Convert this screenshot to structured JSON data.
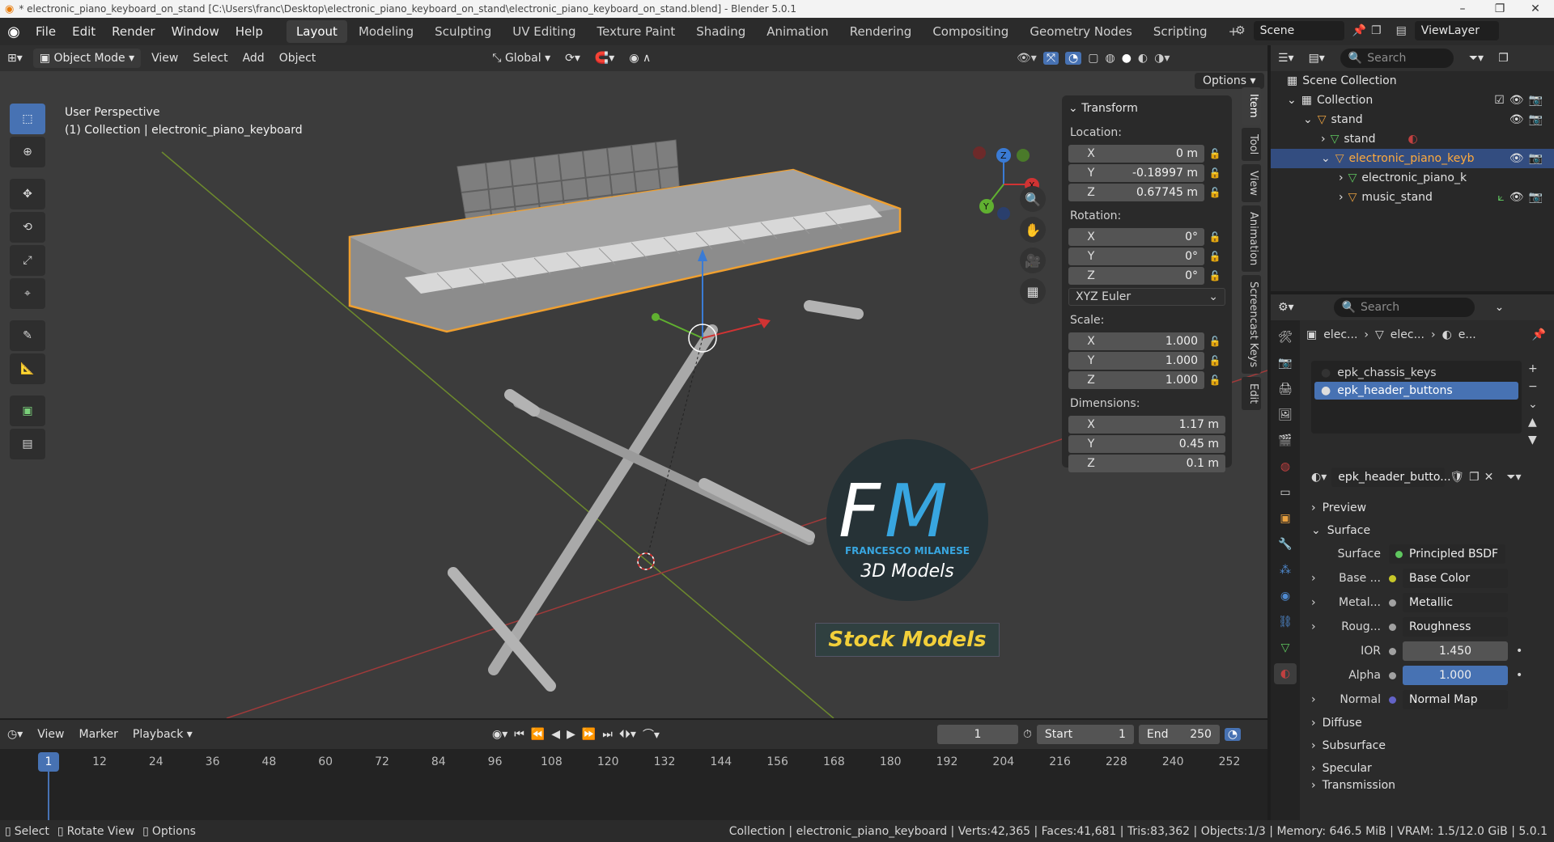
{
  "window": {
    "title": "* electronic_piano_keyboard_on_stand [C:\\Users\\franc\\Desktop\\electronic_piano_keyboard_on_stand\\electronic_piano_keyboard_on_stand.blend] - Blender 5.0.1"
  },
  "menu": [
    "File",
    "Edit",
    "Render",
    "Window",
    "Help"
  ],
  "workspaces": [
    {
      "label": "Layout",
      "active": true
    },
    {
      "label": "Modeling"
    },
    {
      "label": "Sculpting"
    },
    {
      "label": "UV Editing"
    },
    {
      "label": "Texture Paint"
    },
    {
      "label": "Shading"
    },
    {
      "label": "Animation"
    },
    {
      "label": "Rendering"
    },
    {
      "label": "Compositing"
    },
    {
      "label": "Geometry Nodes"
    },
    {
      "label": "Scripting"
    }
  ],
  "scene": {
    "name": "Scene",
    "view_layer": "ViewLayer"
  },
  "viewport_header": {
    "mode": "Object Mode",
    "items": [
      "View",
      "Select",
      "Add",
      "Object"
    ],
    "orientation": "Global",
    "options": "Options"
  },
  "viewport": {
    "perspective": "User Perspective",
    "collection_info": "(1) Collection | electronic_piano_keyboard"
  },
  "transform": {
    "title": "Transform",
    "location_label": "Location:",
    "location": [
      {
        "axis": "X",
        "value": "0 m"
      },
      {
        "axis": "Y",
        "value": "-0.18997 m"
      },
      {
        "axis": "Z",
        "value": "0.67745 m"
      }
    ],
    "rotation_label": "Rotation:",
    "rotation": [
      {
        "axis": "X",
        "value": "0°"
      },
      {
        "axis": "Y",
        "value": "0°"
      },
      {
        "axis": "Z",
        "value": "0°"
      }
    ],
    "rotation_mode": "XYZ Euler",
    "scale_label": "Scale:",
    "scale": [
      {
        "axis": "X",
        "value": "1.000"
      },
      {
        "axis": "Y",
        "value": "1.000"
      },
      {
        "axis": "Z",
        "value": "1.000"
      }
    ],
    "dimensions_label": "Dimensions:",
    "dimensions": [
      {
        "axis": "X",
        "value": "1.17 m"
      },
      {
        "axis": "Y",
        "value": "0.45 m"
      },
      {
        "axis": "Z",
        "value": "0.1 m"
      }
    ]
  },
  "side_tabs": [
    "Item",
    "Tool",
    "View",
    "Animation",
    "Screencast Keys",
    "Edit"
  ],
  "watermark": {
    "initials": "FM",
    "name": "FRANCESCO MILANESE",
    "subtitle": "3D Models",
    "banner": "Stock Models"
  },
  "timeline": {
    "menus": [
      "View",
      "Marker",
      "Playback"
    ],
    "current_frame": "1",
    "start_label": "Start",
    "start": "1",
    "end_label": "End",
    "end": "250",
    "ticks": [
      "12",
      "24",
      "36",
      "48",
      "60",
      "72",
      "84",
      "96",
      "108",
      "120",
      "132",
      "144",
      "156",
      "168",
      "180",
      "192",
      "204",
      "216",
      "228",
      "240",
      "252"
    ]
  },
  "statusbar": {
    "left": [
      "Select",
      "Rotate View",
      "Options"
    ],
    "right": "Collection | electronic_piano_keyboard | Verts:42,365 | Faces:41,681 | Tris:83,362 | Objects:1/3 | Memory: 646.5 MiB | VRAM: 1.5/12.0 GiB | 5.0.1"
  },
  "outliner": {
    "search_placeholder": "Search",
    "rows": [
      {
        "label": "Scene Collection",
        "indent": 0
      },
      {
        "label": "Collection",
        "indent": 1
      },
      {
        "label": "stand",
        "indent": 2
      },
      {
        "label": "stand",
        "indent": 3
      },
      {
        "label": "electronic_piano_keyb",
        "indent": 3,
        "selected": true
      },
      {
        "label": "electronic_piano_k",
        "indent": 4
      },
      {
        "label": "music_stand",
        "indent": 4
      }
    ]
  },
  "properties": {
    "search_placeholder": "Search",
    "breadcrumb": [
      "elec...",
      "elec...",
      "e..."
    ],
    "material_slots": [
      {
        "name": "epk_chassis_keys"
      },
      {
        "name": "epk_header_buttons",
        "selected": true
      }
    ],
    "material_name": "epk_header_butto...",
    "sections": [
      "Preview",
      "Surface"
    ],
    "surface_label": "Surface",
    "surface_value": "Principled BSDF",
    "inputs": [
      {
        "label": "Base ...",
        "value": "Base Color",
        "dot": "#c7c729",
        "expand": true
      },
      {
        "label": "Metal...",
        "value": "Metallic",
        "dot": "#a1a1a1",
        "expand": true
      },
      {
        "label": "Roug...",
        "value": "Roughness",
        "dot": "#a1a1a1",
        "expand": true
      },
      {
        "label": "IOR",
        "value": "1.450",
        "dot": "#a1a1a1",
        "slider": true
      },
      {
        "label": "Alpha",
        "value": "1.000",
        "dot": "#a1a1a1",
        "slider": true,
        "fill": true
      },
      {
        "label": "Normal",
        "value": "Normal Map",
        "dot": "#6363c7",
        "expand": true
      }
    ],
    "subsections": [
      "Diffuse",
      "Subsurface",
      "Specular",
      "Transmission"
    ]
  },
  "colors": {
    "accent": "#4772b3",
    "selection_outline": "#f0a030",
    "banner_text": "#f2cf3a"
  }
}
